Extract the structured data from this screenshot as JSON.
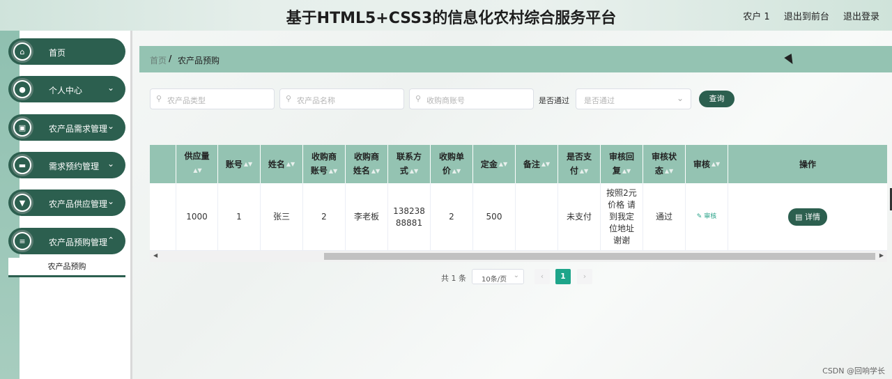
{
  "header": {
    "title": "基于HTML5+CSS3的信息化农村综合服务平台",
    "user": "农户 1",
    "back_front": "退出到前台",
    "logout": "退出登录"
  },
  "sidebar": {
    "items": [
      {
        "label": "首页",
        "icon": "home-icon",
        "glyph": "⌂",
        "expandable": false
      },
      {
        "label": "个人中心",
        "icon": "user-icon",
        "glyph": "●",
        "expandable": true
      },
      {
        "label": "农产品需求管理",
        "icon": "clipboard-icon",
        "glyph": "▣",
        "expandable": true
      },
      {
        "label": "需求预约管理",
        "icon": "monitor-icon",
        "glyph": "▬",
        "expandable": true
      },
      {
        "label": "农产品供应管理",
        "icon": "box-icon",
        "glyph": "▼",
        "expandable": true
      },
      {
        "label": "农产品预购管理",
        "icon": "sliders-icon",
        "glyph": "≡",
        "expandable": true
      }
    ],
    "submenu_active": "农产品预购",
    "chevron": "⌄"
  },
  "breadcrumb": {
    "home": "首页",
    "separator": "/",
    "current": "农产品预购"
  },
  "search": {
    "type_placeholder": "农产品类型",
    "name_placeholder": "农产品名称",
    "buyer_placeholder": "收购商账号",
    "approved_label": "是否通过",
    "approved_placeholder": "是否通过",
    "query_button": "查询"
  },
  "table": {
    "headers": [
      "",
      "供应量",
      "账号",
      "姓名",
      "收购商账号",
      "收购商姓名",
      "联系方式",
      "收购单价",
      "定金",
      "备注",
      "是否支付",
      "审核回复",
      "审核状态",
      "审核",
      "操作"
    ],
    "header_lines": [
      [
        ""
      ],
      [
        "供应量"
      ],
      [
        "账号"
      ],
      [
        "姓名"
      ],
      [
        "收购商",
        "账号"
      ],
      [
        "收购商",
        "姓名"
      ],
      [
        "联系方",
        "式"
      ],
      [
        "收购单",
        "价"
      ],
      [
        "定金"
      ],
      [
        "备注"
      ],
      [
        "是否支",
        "付"
      ],
      [
        "审核回",
        "复"
      ],
      [
        "审核状",
        "态"
      ],
      [
        "审核"
      ],
      [
        "操作"
      ]
    ],
    "rows": [
      {
        "supply": "1000",
        "account": "1",
        "name": "张三",
        "buyer_account": "2",
        "buyer_name": "李老板",
        "contact_1": "138238",
        "contact_2": "88881",
        "unit_price": "2",
        "deposit": "500",
        "note": "",
        "paid": "未支付",
        "reply_lines": [
          "按照2元",
          "价格 请",
          "到我定",
          "位地址",
          "谢谢"
        ],
        "status": "通过",
        "audit_link": "审核",
        "detail_button": "详情"
      }
    ]
  },
  "pagination": {
    "total": "共 1 条",
    "page_size": "10条/页",
    "current": "1",
    "prev": "‹",
    "next": "›"
  },
  "watermark": "CSDN @回响学长",
  "colors": {
    "primary": "#2c5f4f",
    "accent": "#94c3b2",
    "active_page": "#1ea58a"
  }
}
